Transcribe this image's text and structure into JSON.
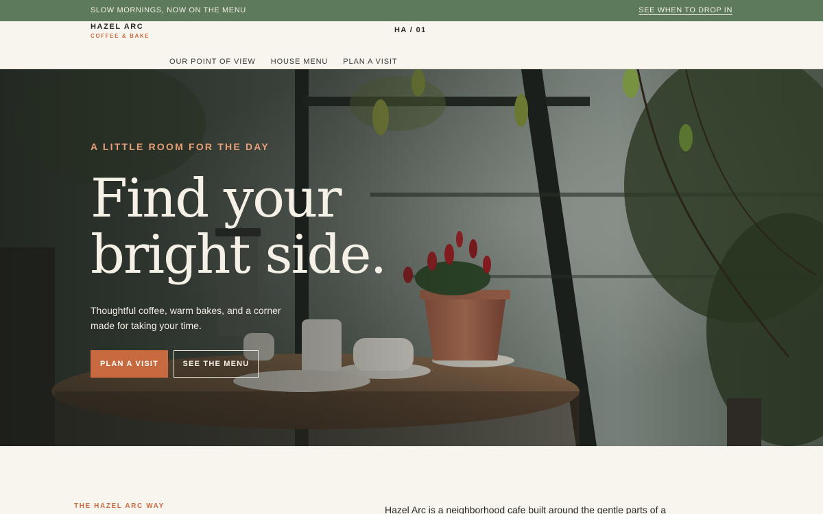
{
  "announcement": {
    "message": "SLOW MORNINGS, NOW ON THE MENU",
    "link": "SEE WHEN TO DROP IN"
  },
  "header": {
    "brand_name": "HAZEL ARC",
    "brand_tagline": "COFFEE & BAKE",
    "issue_label": "HA / 01",
    "nav": [
      {
        "label": "OUR POINT OF VIEW"
      },
      {
        "label": "HOUSE MENU"
      },
      {
        "label": "PLAN A VISIT"
      }
    ]
  },
  "hero": {
    "eyebrow": "A LITTLE ROOM FOR THE DAY",
    "headline": "Find your bright side.",
    "subtext": "Thoughtful coffee, warm bakes, and a corner made for taking your time.",
    "primary_button": "PLAN A VISIT",
    "secondary_button": "SEE THE MENU"
  },
  "section": {
    "kicker": "THE HAZEL ARC WAY",
    "intro": "Hazel Arc is a neighborhood cafe built around the gentle parts of a"
  },
  "colors": {
    "topbar": "#5e7a5c",
    "accent": "#c86a40",
    "eyebrow": "#e8a07a",
    "background": "#f8f5ef"
  }
}
